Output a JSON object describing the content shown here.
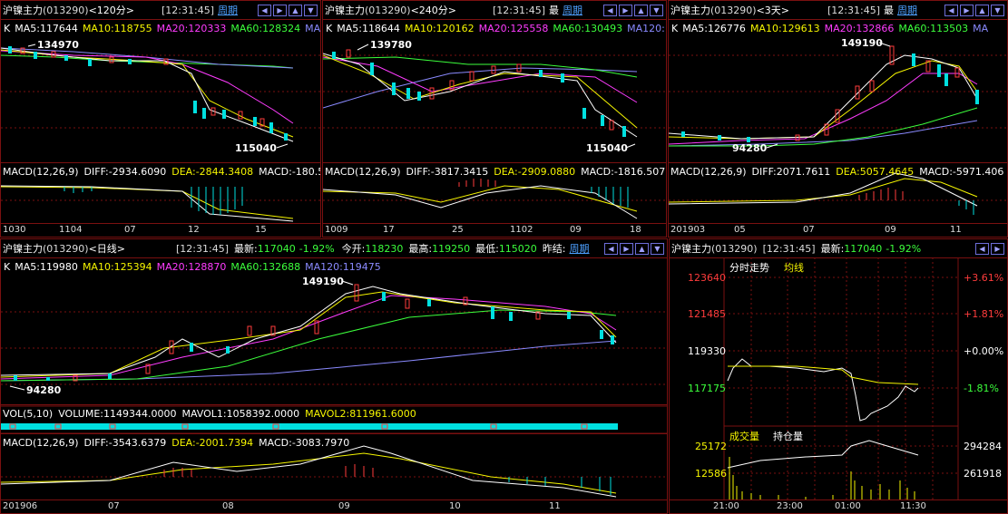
{
  "common": {
    "name": "沪镍主力",
    "code": "(013290)",
    "time": "[12:31:45]",
    "period_link": "周期",
    "ann_high": "149190",
    "ann_low": "94280"
  },
  "panel1": {
    "interval": "<120分>",
    "ma": {
      "k": "K",
      "ma5": "MA5:117644",
      "ma10": "MA10:118755",
      "ma20": "MA20:120333",
      "ma60": "MA60:128324",
      "ma120": "MA"
    },
    "ann_high": "134970",
    "ann_low": "115040",
    "macd": {
      "label": "MACD(12,26,9)",
      "diff": "DIFF:-2934.6090",
      "dea": "DEA:-2844.3408",
      "macd": "MACD:-180.5"
    },
    "xlabels": [
      "1030",
      "1104",
      "07",
      "12",
      "15"
    ]
  },
  "panel2": {
    "interval": "<240分>",
    "extra": "最",
    "ma": {
      "k": "K",
      "ma5": "MA5:118644",
      "ma10": "MA10:120162",
      "ma20": "MA20:125558",
      "ma60": "MA60:130493",
      "ma120": "MA120:"
    },
    "ann_high": "139780",
    "ann_low": "115040",
    "macd": {
      "label": "MACD(12,26,9)",
      "diff": "DIFF:-3817.3415",
      "dea": "DEA:-2909.0880",
      "macd": "MACD:-1816.507"
    },
    "xlabels": [
      "1009",
      "17",
      "25",
      "1102",
      "09",
      "18"
    ]
  },
  "panel3": {
    "interval": "<3天>",
    "extra": "最",
    "ma": {
      "k": "K",
      "ma5": "MA5:126776",
      "ma10": "MA10:129613",
      "ma20": "MA20:132866",
      "ma60": "MA60:113503",
      "ma120": "MA"
    },
    "macd": {
      "label": "MACD(12,26,9)",
      "diff": "DIFF:2071.7611",
      "dea": "DEA:5057.4645",
      "macd": "MACD:-5971.406"
    },
    "xlabels": [
      "201903",
      "05",
      "07",
      "09",
      "11"
    ]
  },
  "panel4": {
    "interval": "<日线>",
    "quote": {
      "latest_label": "最新:",
      "latest": "117040",
      "change": "-1.92%",
      "open_label": "今开:",
      "open": "118230",
      "high_label": "最高:",
      "high": "119250",
      "low_label": "最低:",
      "low": "115020",
      "prev_label": "昨结:"
    },
    "ma": {
      "k": "K",
      "ma5": "MA5:119980",
      "ma10": "MA10:125394",
      "ma20": "MA20:128870",
      "ma60": "MA60:132688",
      "ma120": "MA120:119475"
    },
    "vol": {
      "label": "VOL(5,10)",
      "volume": "VOLUME:1149344.0000",
      "mavol1": "MAVOL1:1058392.0000",
      "mavol2": "MAVOL2:811961.6000"
    },
    "macd": {
      "label": "MACD(12,26,9)",
      "diff": "DIFF:-3543.6379",
      "dea": "DEA:-2001.7394",
      "macd": "MACD:-3083.7970"
    },
    "xlabels": [
      "201906",
      "07",
      "08",
      "09",
      "10",
      "11"
    ]
  },
  "panel5": {
    "latest_label": "最新:",
    "latest": "117040",
    "change": "-1.92%",
    "timeshare_label": "分时走势",
    "avg_label": "均线",
    "price_labels": [
      "123640",
      "121485",
      "119330",
      "117175"
    ],
    "pct_labels": [
      "+3.61%",
      "+1.81%",
      "+0.00%",
      "-1.81%"
    ],
    "vol_label": "成交量",
    "oi_label": "持仓量",
    "vol_labels": [
      "25172",
      "12586"
    ],
    "oi_labels": [
      "294284",
      "261918"
    ],
    "time_labels": [
      "21:00",
      "23:00",
      "01:00",
      "11:30"
    ]
  },
  "colors": {
    "red": "#ff3c3c",
    "cyan": "#00e0e0",
    "yellow": "#f5f500",
    "magenta": "#ff3cff",
    "green": "#3cff3c",
    "blue": "#8a8aff",
    "grid": "#7a1010"
  }
}
